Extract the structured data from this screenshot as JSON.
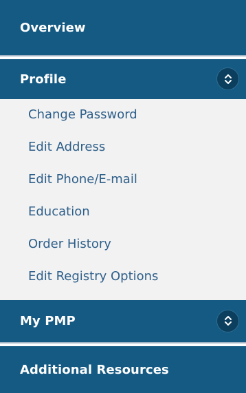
{
  "nav": {
    "overview": {
      "label": "Overview"
    },
    "profile": {
      "label": "Profile",
      "toggle_icon": "chevron-up-down-icon",
      "items": [
        {
          "label": "Change Password"
        },
        {
          "label": "Edit Address"
        },
        {
          "label": "Edit Phone/E-mail"
        },
        {
          "label": "Education"
        },
        {
          "label": "Order History"
        },
        {
          "label": "Edit Registry Options"
        }
      ]
    },
    "my_pmp": {
      "label": "My PMP",
      "toggle_icon": "chevron-up-down-icon"
    },
    "additional_resources": {
      "label": "Additional Resources"
    }
  },
  "colors": {
    "header_bg": "#155a83",
    "toggle_bg": "#0c3f5e",
    "submenu_bg": "#f2f2f2",
    "link": "#2e5f8a"
  }
}
